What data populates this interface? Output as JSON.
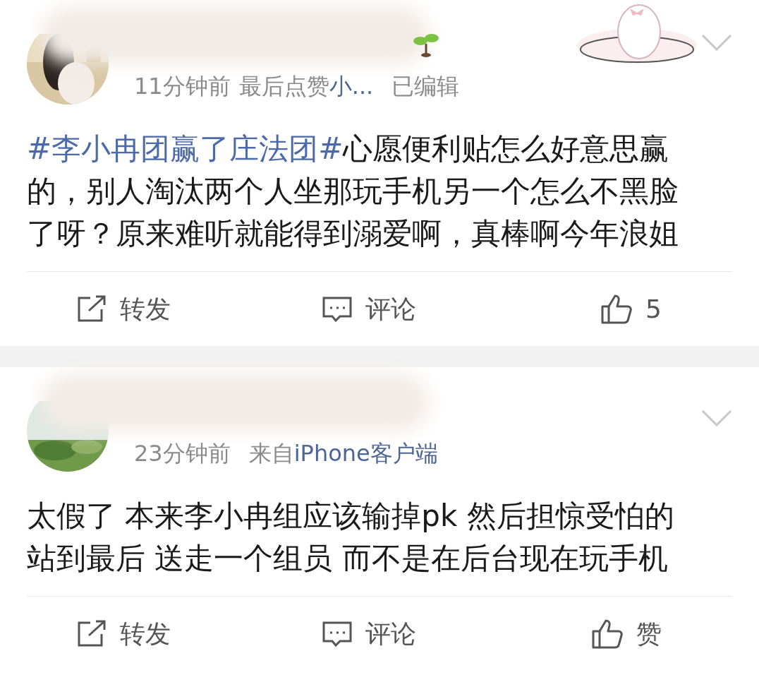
{
  "posts": [
    {
      "meta": [
        {
          "kind": "time",
          "text": "11分钟前"
        },
        {
          "kind": "plain",
          "text": "最后点赞"
        },
        {
          "kind": "link",
          "text": "小..."
        },
        {
          "kind": "gap",
          "text": "已编辑"
        }
      ],
      "has_badge": true,
      "has_sticker": true,
      "lines": [
        {
          "hashtag": "#李小冉团赢了庄法团#",
          "text": "心愿便利贴怎么好意思赢"
        },
        {
          "text": "的，别人淘汰两个人坐那玩手机另一个怎么不黑脸"
        },
        {
          "text": "了呀？原来难听就能得到溺爱啊，真棒啊今年浪姐"
        }
      ],
      "actions": [
        {
          "kind": "repost",
          "label": "转发"
        },
        {
          "kind": "comment",
          "label": "评论"
        },
        {
          "kind": "like",
          "label": "5"
        }
      ]
    },
    {
      "meta": [
        {
          "kind": "time",
          "text": "23分钟前"
        },
        {
          "kind": "gap",
          "text": "来自"
        },
        {
          "kind": "link",
          "text": "iPhone客户端"
        }
      ],
      "has_badge": false,
      "has_sticker": false,
      "lines": [
        {
          "text": "太假了 本来李小冉组应该输掉pk 然后担惊受怕的"
        },
        {
          "text": "站到最后 送走一个组员 而不是在后台现在玩手机"
        }
      ],
      "actions": [
        {
          "kind": "repost",
          "label": "转发"
        },
        {
          "kind": "comment",
          "label": "评论"
        },
        {
          "kind": "like",
          "label": "赞"
        }
      ]
    }
  ]
}
